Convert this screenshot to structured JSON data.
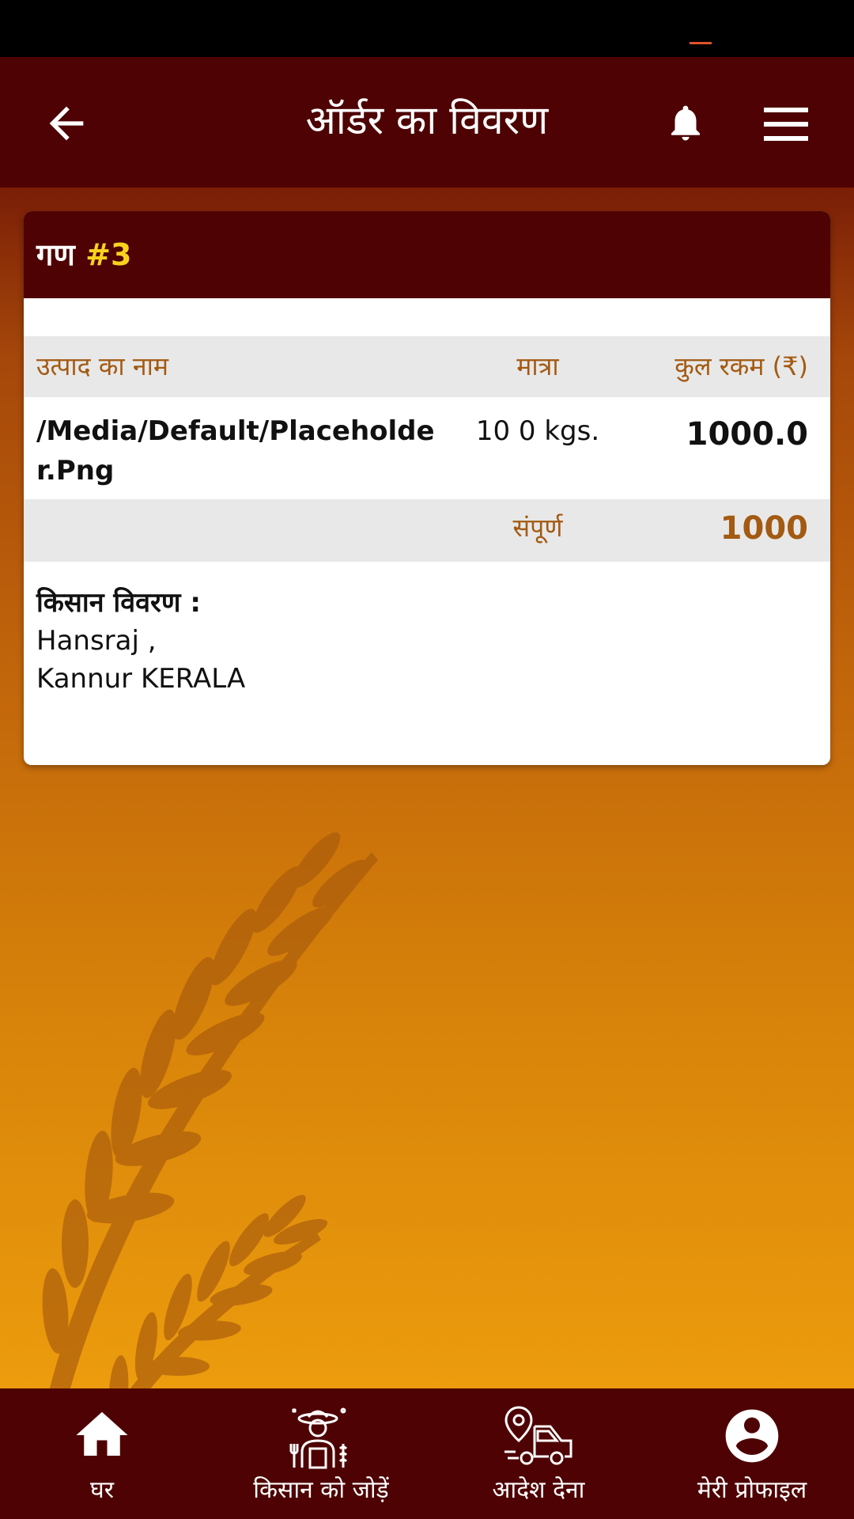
{
  "app_bar": {
    "title": "ऑर्डर का विवरण",
    "icons": [
      "back-arrow-icon",
      "bell-icon",
      "hamburger-menu-icon"
    ]
  },
  "order": {
    "prefix": "गण ",
    "number": "#3",
    "columns": {
      "product": "उत्पाद का नाम",
      "quantity": "मात्रा",
      "amount": "कुल रकम (₹)"
    },
    "items": [
      {
        "product": "/Media/Default/Placeholder.Png",
        "quantity": "10 0 kgs.",
        "amount": "1000.0"
      }
    ],
    "total_label": "संपूर्ण",
    "total_value": "1000"
  },
  "farmer": {
    "label": "किसान विवरण :",
    "name": "Hansraj ,",
    "location": "Kannur KERALA"
  },
  "bottom_nav": [
    {
      "label": "घर",
      "icon": "home-icon"
    },
    {
      "label": "किसान को जोड़ें",
      "icon": "farmer-icon"
    },
    {
      "label": "आदेश देना",
      "icon": "delivery-truck-icon"
    },
    {
      "label": "मेरी प्रोफाइल",
      "icon": "profile-icon"
    }
  ],
  "colors": {
    "header_bg": "#4e0203",
    "accent": "#f8d21e",
    "label_brown": "#a35a12"
  }
}
